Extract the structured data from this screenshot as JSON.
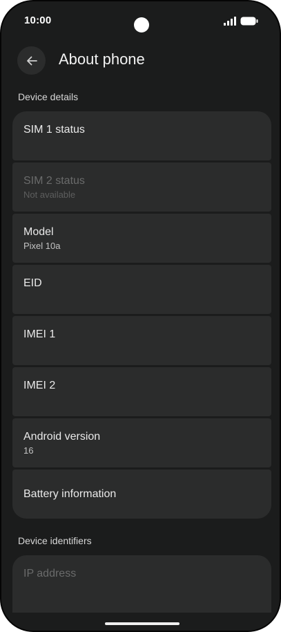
{
  "status_bar": {
    "time": "10:00",
    "signal_icon": "cellular-signal-icon",
    "battery_icon": "battery-full-icon"
  },
  "app_bar": {
    "back_icon": "arrow-back-icon",
    "title": "About phone"
  },
  "sections": {
    "device_details": {
      "header": "Device details",
      "items": [
        {
          "title": "SIM 1 status",
          "subtitle": "",
          "enabled": true
        },
        {
          "title": "SIM 2 status",
          "subtitle": "Not available",
          "enabled": false
        },
        {
          "title": "Model",
          "subtitle": "Pixel 10a",
          "enabled": true
        },
        {
          "title": "EID",
          "subtitle": "",
          "enabled": true
        },
        {
          "title": "IMEI 1",
          "subtitle": "",
          "enabled": true
        },
        {
          "title": "IMEI 2",
          "subtitle": "",
          "enabled": true
        },
        {
          "title": "Android version",
          "subtitle": "16",
          "enabled": true
        },
        {
          "title": "Battery information",
          "subtitle": "",
          "enabled": true
        }
      ]
    },
    "device_identifiers": {
      "header": "Device identifiers",
      "items": [
        {
          "title": "IP address",
          "subtitle": "",
          "enabled": false
        }
      ]
    }
  },
  "colors": {
    "background": "#1b1c1c",
    "card": "#2b2c2c",
    "text_primary": "#eaeaea",
    "text_disabled": "#6a6b6b"
  }
}
